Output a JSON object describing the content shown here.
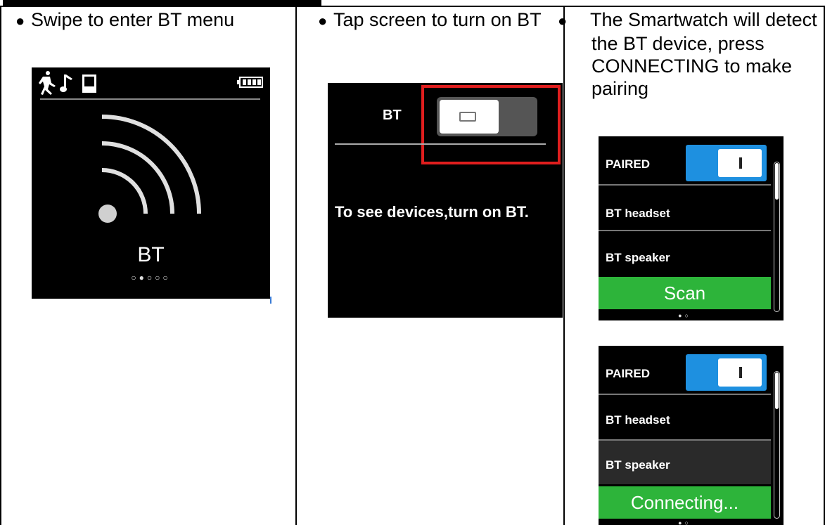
{
  "columns": [
    {
      "bullet": "●",
      "text": "Swipe to enter BT menu"
    },
    {
      "bullet": "●",
      "text": "Tap screen to turn on BT"
    },
    {
      "bullet": "●",
      "text": "The Smartwatch will detect the BT device, press CONNECTING to make pairing"
    }
  ],
  "screen1": {
    "label": "BT",
    "page_dots": "○●○○○",
    "status_icons": [
      "running-icon",
      "music-icon",
      "watch-icon",
      "battery-icon"
    ]
  },
  "screen2": {
    "toggle_label": "BT",
    "message": "To see devices,turn on BT.",
    "highlight_color": "#e01e1e"
  },
  "screen3a": {
    "paired_label": "PAIRED",
    "devices": [
      "BT headset",
      "BT speaker"
    ],
    "action": "Scan",
    "page_dots": "●○"
  },
  "screen3b": {
    "paired_label": "PAIRED",
    "devices": [
      "BT headset",
      "BT speaker"
    ],
    "action": "Connecting...",
    "page_dots": "●○"
  },
  "colors": {
    "toggle_on": "#1e90e0",
    "action_green": "#2db43a"
  }
}
